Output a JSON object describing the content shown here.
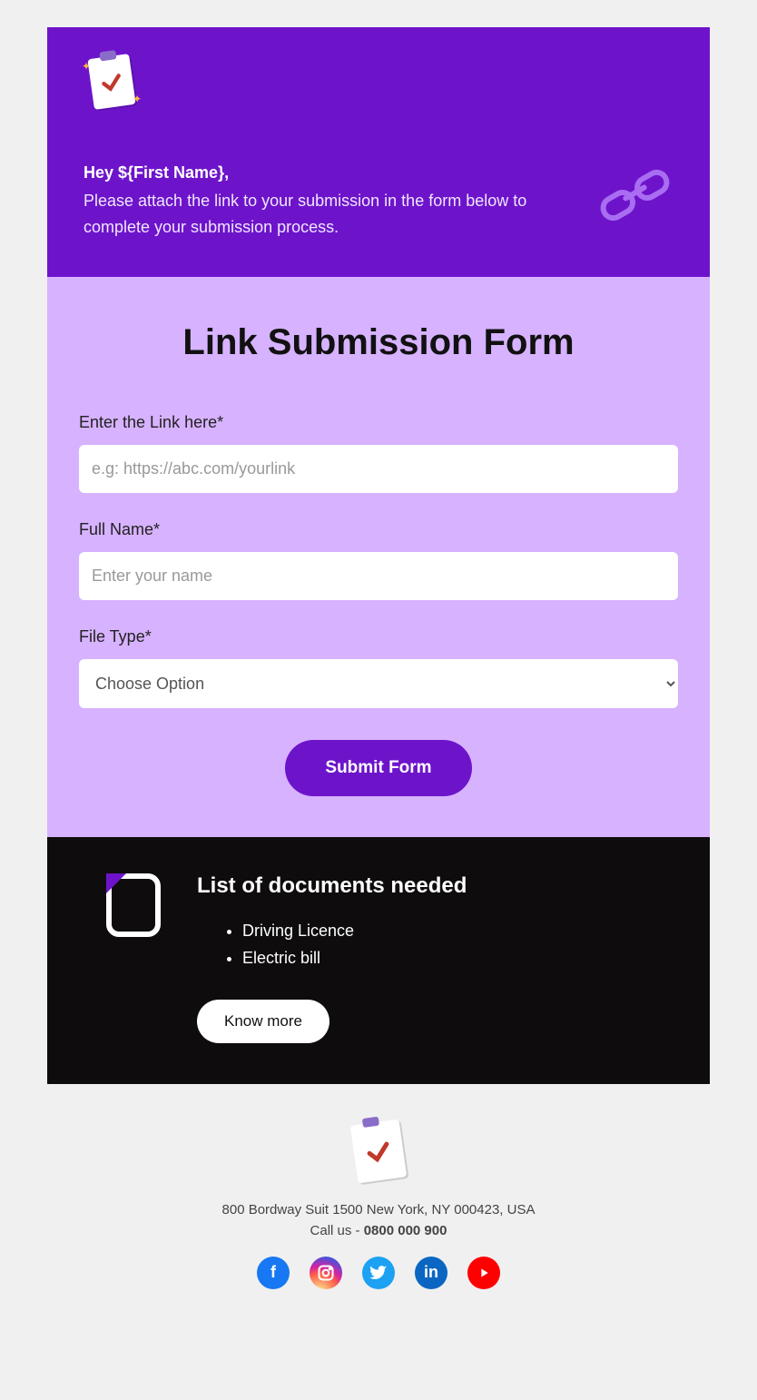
{
  "header": {
    "greeting": "Hey ${First Name},",
    "instruction": "Please attach the link to your submission in the form below to complete your submission process."
  },
  "form": {
    "title": "Link Submission Form",
    "link_label": "Enter the Link here*",
    "link_placeholder": "e.g: https://abc.com/yourlink",
    "name_label": "Full Name*",
    "name_placeholder": "Enter your name",
    "filetype_label": "File Type*",
    "filetype_option": "Choose Option",
    "submit_label": "Submit Form"
  },
  "docs": {
    "title": "List of documents needed",
    "items": [
      "Driving Licence",
      "Electric bill"
    ],
    "know_more": "Know more"
  },
  "footer": {
    "address": "800 Bordway Suit 1500 New York, NY 000423, USA",
    "call_label": "Call us - ",
    "phone": "0800 000 900"
  }
}
